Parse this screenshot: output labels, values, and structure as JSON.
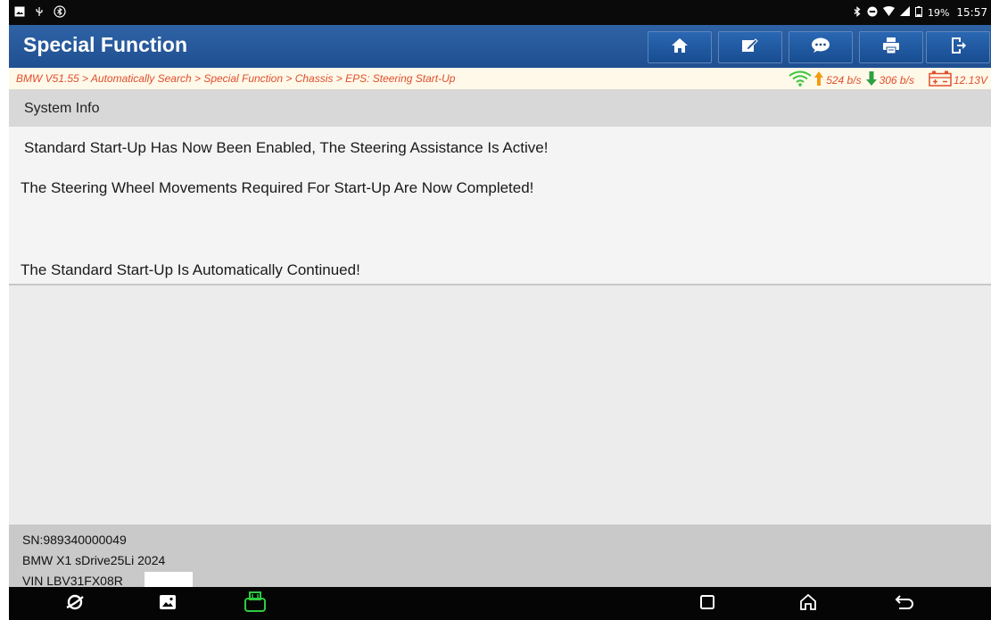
{
  "status_bar": {
    "left_icons": [
      "image-notification-icon",
      "usb-icon",
      "bluetooth-settings-icon"
    ],
    "right_icons": [
      "bluetooth-icon",
      "do-not-disturb-icon",
      "wifi-icon",
      "signal-icon",
      "battery-icon"
    ],
    "battery": "19%",
    "time": "15:57"
  },
  "header": {
    "title": "Special Function",
    "buttons": [
      "home-icon",
      "edit-icon",
      "message-icon",
      "print-icon",
      "exit-icon"
    ]
  },
  "breadcrumb": {
    "text": "BMW V51.55 > Automatically Search > Special Function > Chassis > EPS: Steering Start-Up",
    "upload_speed": "524 b/s",
    "download_speed": "306 b/s",
    "voltage": "12.13V"
  },
  "content": {
    "section_title": "System Info",
    "messages": [
      "Standard Start-Up Has Now Been Enabled, The Steering Assistance Is Active!",
      "The Steering Wheel Movements Required For Start-Up Are Now Completed!",
      "The Standard Start-Up Is Automatically Continued!"
    ]
  },
  "footer": {
    "sn": "SN:989340000049",
    "vehicle": "BMW X1 sDrive25Li 2024",
    "vin": "VIN LBV31FX08R"
  },
  "nav_bar": {
    "left_buttons": [
      "browser-icon",
      "gallery-icon",
      "vci-icon"
    ],
    "right_buttons": [
      "recent-apps-icon",
      "home-nav-icon",
      "back-icon"
    ]
  },
  "colors": {
    "title_bar": "#2a5da0",
    "breadcrumb_text": "#e04e2b",
    "upload_arrow": "#f39c12",
    "download_arrow": "#2ea043",
    "wifi": "#3cc43c",
    "vci_icon": "#2ecc40"
  }
}
